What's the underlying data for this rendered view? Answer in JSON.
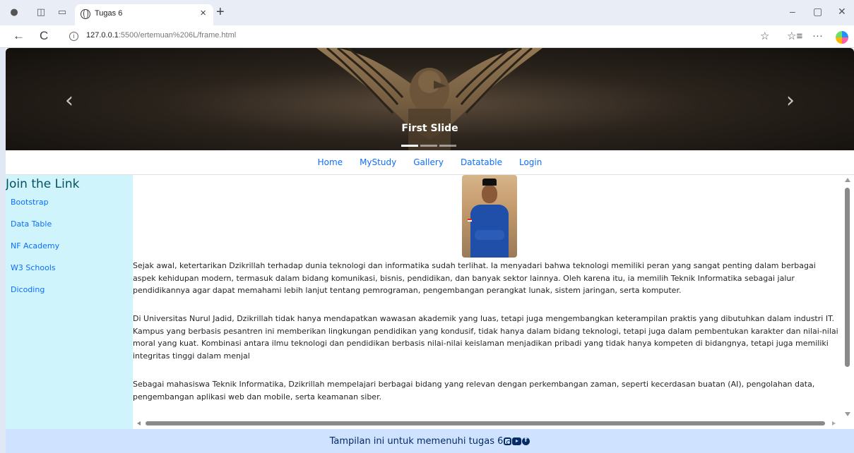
{
  "browser": {
    "tab_title": "Tugas 6",
    "tab_close": "×",
    "new_tab": "+",
    "url_host": "127.0.0.1",
    "url_path": ":5500/ertemuan%206L/frame.html",
    "back": "←",
    "reload": "C",
    "info": "i",
    "favorite": "☆",
    "favorites_bar": "☆≡",
    "more": "···",
    "minimize": "–",
    "restore": "▢",
    "close": "✕"
  },
  "carousel": {
    "caption": "First Slide",
    "prev": "‹",
    "next": "›",
    "slides": 3,
    "active_slide": 1
  },
  "nav": {
    "items": [
      {
        "label": "Home"
      },
      {
        "label": "MyStudy"
      },
      {
        "label": "Gallery"
      },
      {
        "label": "Datatable"
      },
      {
        "label": "Login"
      }
    ]
  },
  "sidebar": {
    "title": "Join the Link",
    "items": [
      {
        "label": "Bootstrap"
      },
      {
        "label": "Data Table"
      },
      {
        "label": "NF Academy"
      },
      {
        "label": "W3 Schools"
      },
      {
        "label": "Dicoding"
      }
    ]
  },
  "content": {
    "paragraphs": [
      "Sejak awal, ketertarikan Dzikrillah terhadap dunia teknologi dan informatika sudah terlihat. Ia menyadari bahwa teknologi memiliki peran yang sangat penting dalam berbagai aspek kehidupan modern, termasuk dalam bidang komunikasi, bisnis, pendidikan, dan banyak sektor lainnya. Oleh karena itu, ia memilih Teknik Informatika sebagai jalur pendidikannya agar dapat memahami lebih lanjut tentang pemrograman, pengembangan perangkat lunak, sistem jaringan, serta komputer.",
      "Di Universitas Nurul Jadid, Dzikrillah tidak hanya mendapatkan wawasan akademik yang luas, tetapi juga mengembangkan keterampilan praktis yang dibutuhkan dalam industri IT. Kampus yang berbasis pesantren ini memberikan lingkungan pendidikan yang kondusif, tidak hanya dalam bidang teknologi, tetapi juga dalam pembentukan karakter dan nilai-nilai moral yang kuat. Kombinasi antara ilmu teknologi dan pendidikan berbasis nilai-nilai keislaman menjadikan pribadi yang tidak hanya kompeten di bidangnya, tetapi juga memiliki integritas tinggi dalam menjal",
      "Sebagai mahasiswa Teknik Informatika, Dzikrillah mempelajari berbagai bidang yang relevan dengan perkembangan zaman, seperti kecerdasan buatan (AI), pengolahan data, pengembangan aplikasi web dan mobile, serta keamanan siber."
    ]
  },
  "footer": {
    "text": "Tampilan ini untuk memenuhi tugas 6"
  }
}
